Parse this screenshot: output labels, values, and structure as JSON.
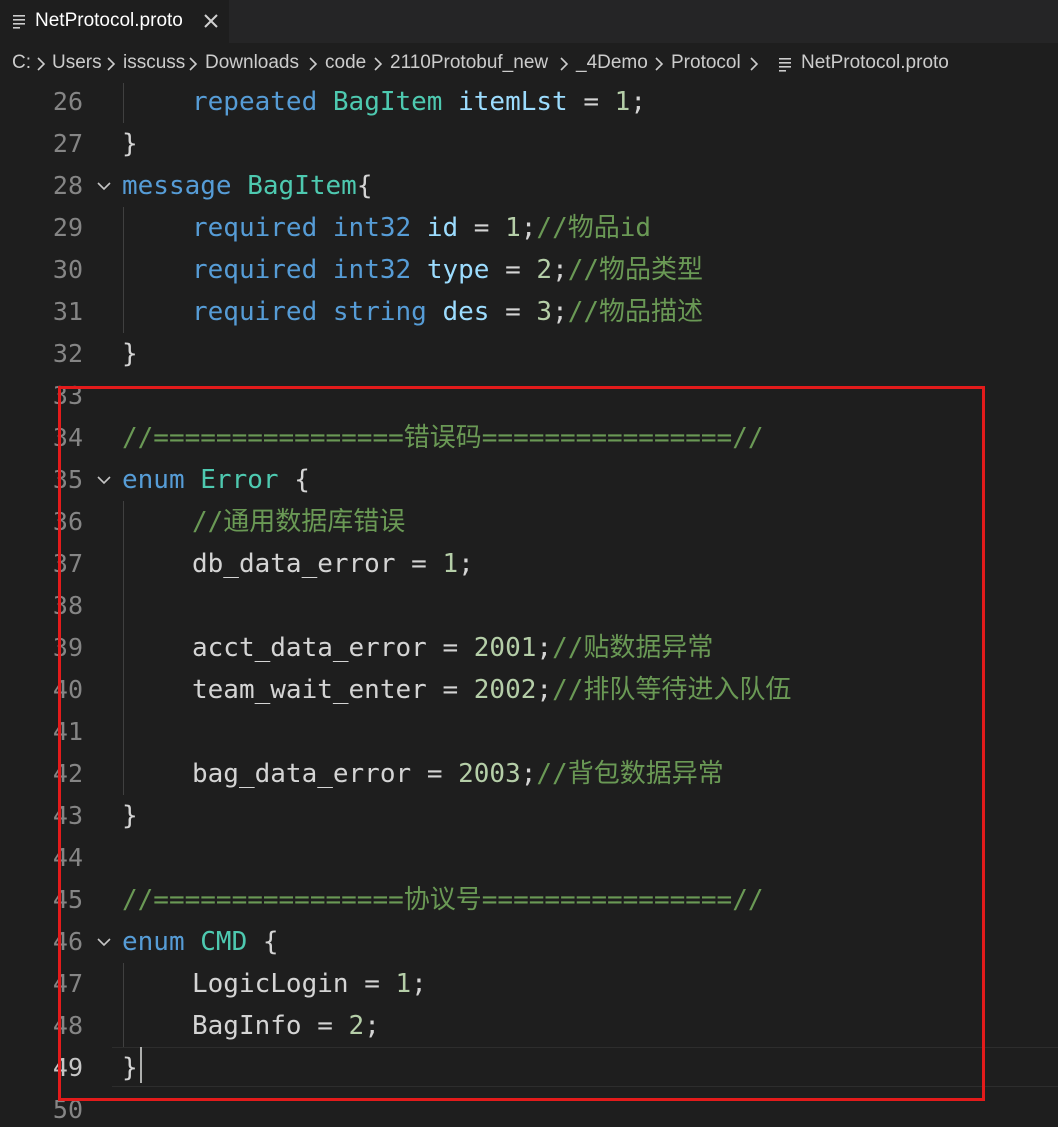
{
  "tab": {
    "label": "NetProtocol.proto",
    "file_icon": "lines-icon",
    "close_icon": "close-icon"
  },
  "breadcrumb": {
    "items": [
      "C:",
      "Users",
      "isscuss",
      "Downloads",
      "code",
      "2110Protobuf_new",
      "_4Demo",
      "Protocol",
      "NetProtocol.proto"
    ],
    "separator_icon": "chevron-right-icon"
  },
  "editor": {
    "current_line": "49",
    "line_numbers": [
      "26",
      "27",
      "28",
      "29",
      "30",
      "31",
      "32",
      "33",
      "34",
      "35",
      "36",
      "37",
      "38",
      "39",
      "40",
      "41",
      "42",
      "43",
      "44",
      "45",
      "46",
      "47",
      "48",
      "49",
      "50"
    ],
    "lines": {
      "l26": {
        "kw": "repeated",
        "type": "BagItem",
        "name": "itemLst",
        "eq": "=",
        "val": "1",
        "end": ";"
      },
      "l27": {
        "text": "}"
      },
      "l28": {
        "kw": "message",
        "type": "BagItem",
        "brace": "{"
      },
      "l29": {
        "kw": "required",
        "type": "int32",
        "name": "id",
        "eq": "=",
        "val": "1",
        "end": ";",
        "comment": "//物品id"
      },
      "l30": {
        "kw": "required",
        "type": "int32",
        "name": "type",
        "eq": "=",
        "val": "2",
        "end": ";",
        "comment": "//物品类型"
      },
      "l31": {
        "kw": "required",
        "type": "string",
        "name": "des",
        "eq": "=",
        "val": "3",
        "end": ";",
        "comment": "//物品描述"
      },
      "l32": {
        "text": "}"
      },
      "l34": {
        "comment": "//================错误码================//"
      },
      "l35": {
        "kw": "enum",
        "type": "Error",
        "brace": "{"
      },
      "l36": {
        "comment": "//通用数据库错误"
      },
      "l37": {
        "name": "db_data_error",
        "eq": "=",
        "val": "1",
        "end": ";"
      },
      "l39": {
        "name": "acct_data_error",
        "eq": "=",
        "val": "2001",
        "end": ";",
        "comment": "//贴数据异常"
      },
      "l40": {
        "name": "team_wait_enter",
        "eq": "=",
        "val": "2002",
        "end": ";",
        "comment": "//排队等待进入队伍"
      },
      "l42": {
        "name": "bag_data_error",
        "eq": "=",
        "val": "2003",
        "end": ";",
        "comment": "//背包数据异常"
      },
      "l43": {
        "text": "}"
      },
      "l45": {
        "comment": "//================协议号================//"
      },
      "l46": {
        "kw": "enum",
        "type": "CMD",
        "brace": "{"
      },
      "l47": {
        "name": "LogicLogin",
        "eq": "=",
        "val": "1",
        "end": ";"
      },
      "l48": {
        "name": "BagInfo",
        "eq": "=",
        "val": "2",
        "end": ";"
      },
      "l49": {
        "text": "}"
      }
    }
  },
  "colors": {
    "background": "#1e1e1e",
    "keyword": "#569cd6",
    "type": "#4ec9b0",
    "identifier": "#9cdcfe",
    "number": "#b5cea8",
    "comment": "#6a9955",
    "highlight_box": "#e31b1b"
  }
}
